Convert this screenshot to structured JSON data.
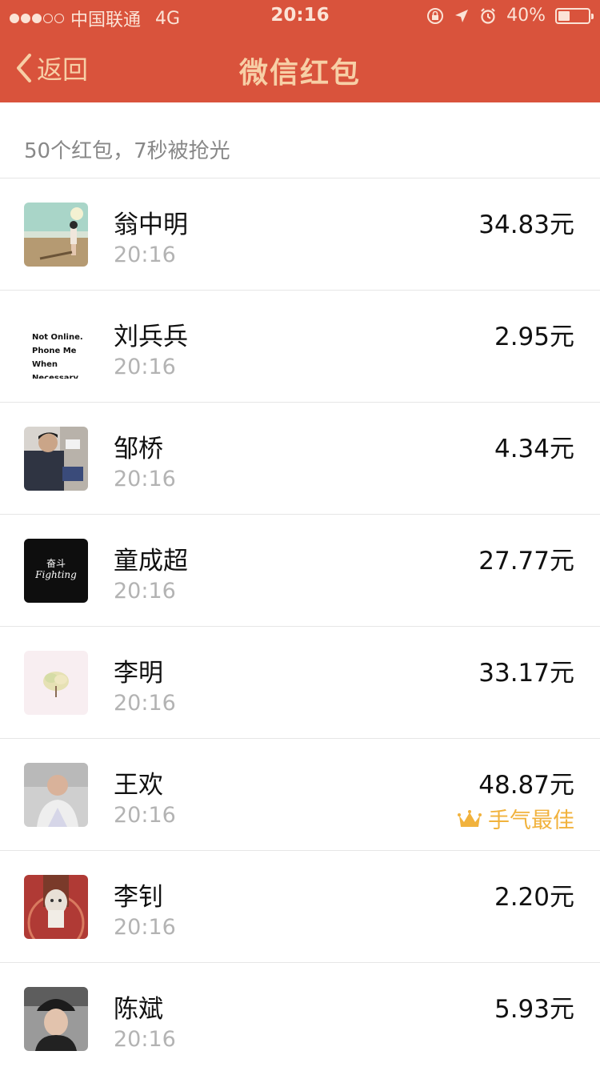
{
  "status_bar": {
    "carrier": "中国联通",
    "network": "4G",
    "time": "20:16",
    "battery": "40%",
    "battery_level": 0.4,
    "signal_bars_filled": 3,
    "signal_bars_total": 5
  },
  "nav": {
    "back_label": "返回",
    "title": "微信红包"
  },
  "summary": "50个红包，7秒被抢光",
  "colors": {
    "header_bg": "#d9533c",
    "header_text": "#f7cfa6",
    "best_luck": "#f1b23c"
  },
  "avatar_texts": {
    "not_online": [
      "Not Online.",
      "Phone Me",
      "When",
      "Necessary."
    ],
    "fight_cn": "奋斗",
    "fight_en": "Fighting"
  },
  "entries": [
    {
      "name": "翁中明",
      "time": "20:16",
      "amount": "34.83元",
      "avatar": "beach-photo"
    },
    {
      "name": "刘兵兵",
      "time": "20:16",
      "amount": "2.95元",
      "avatar": "text-not-online"
    },
    {
      "name": "邹桥",
      "time": "20:16",
      "amount": "4.34元",
      "avatar": "man-laptop-photo"
    },
    {
      "name": "童成超",
      "time": "20:16",
      "amount": "27.77元",
      "avatar": "fighting-dark"
    },
    {
      "name": "李明",
      "time": "20:16",
      "amount": "33.17元",
      "avatar": "tree-pink"
    },
    {
      "name": "王欢",
      "time": "20:16",
      "amount": "48.87元",
      "avatar": "man-portrait-photo",
      "badge": "手气最佳",
      "badge_icon": "crown-icon"
    },
    {
      "name": "李钊",
      "time": "20:16",
      "amount": "2.20元",
      "avatar": "cat-cup-photo"
    },
    {
      "name": "陈斌",
      "time": "20:16",
      "amount": "5.93元",
      "avatar": "man-cap-photo"
    }
  ]
}
